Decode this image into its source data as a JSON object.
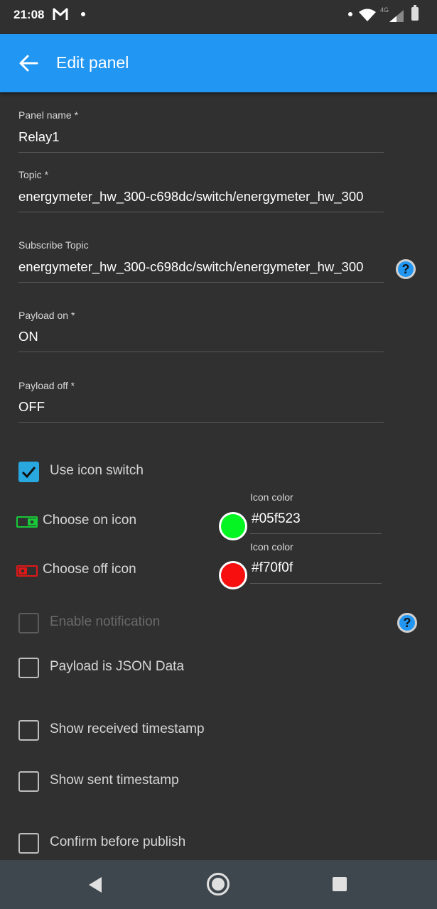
{
  "status_bar": {
    "time": "21:08",
    "network_label": "4G",
    "icons": [
      "gmail-icon",
      "notification-dot",
      "wifi-icon",
      "signal-icon",
      "battery-icon"
    ]
  },
  "app_bar": {
    "title": "Edit panel",
    "back_icon": "arrow-left-icon"
  },
  "form": {
    "panel_name": {
      "label": "Panel name *",
      "value": "Relay1"
    },
    "topic": {
      "label": "Topic *",
      "value": "energymeter_hw_300-c698dc/switch/energymeter_hw_300"
    },
    "subscribe_topic": {
      "label": "Subscribe Topic",
      "value": "energymeter_hw_300-c698dc/switch/energymeter_hw_300"
    },
    "payload_on": {
      "label": "Payload on *",
      "value": "ON"
    },
    "payload_off": {
      "label": "Payload off *",
      "value": "OFF"
    }
  },
  "help_icon_glyph": "?",
  "use_icon_switch": {
    "label": "Use icon switch",
    "checked": true
  },
  "icon_choices": {
    "on": {
      "label": "Choose on icon",
      "color_label": "Icon color",
      "color_value": "#05f523"
    },
    "off": {
      "label": "Choose off icon",
      "color_label": "Icon color",
      "color_value": "#f70f0f"
    }
  },
  "options": [
    {
      "label": "Enable notification",
      "checked": false,
      "disabled": true
    },
    {
      "label": "Payload is JSON Data",
      "checked": false,
      "disabled": false
    },
    {
      "label": "Show received timestamp",
      "checked": false,
      "disabled": false
    },
    {
      "label": "Show sent timestamp",
      "checked": false,
      "disabled": false
    },
    {
      "label": "Confirm before publish",
      "checked": false,
      "disabled": false
    }
  ],
  "colors": {
    "accent": "#2196f3",
    "checkbox_checked": "#29a8e0",
    "background": "#303030",
    "nav_bar": "#3f474e"
  },
  "nav_bar": {
    "buttons": [
      "back-triangle-icon",
      "home-circle-icon",
      "recents-square-icon"
    ]
  }
}
